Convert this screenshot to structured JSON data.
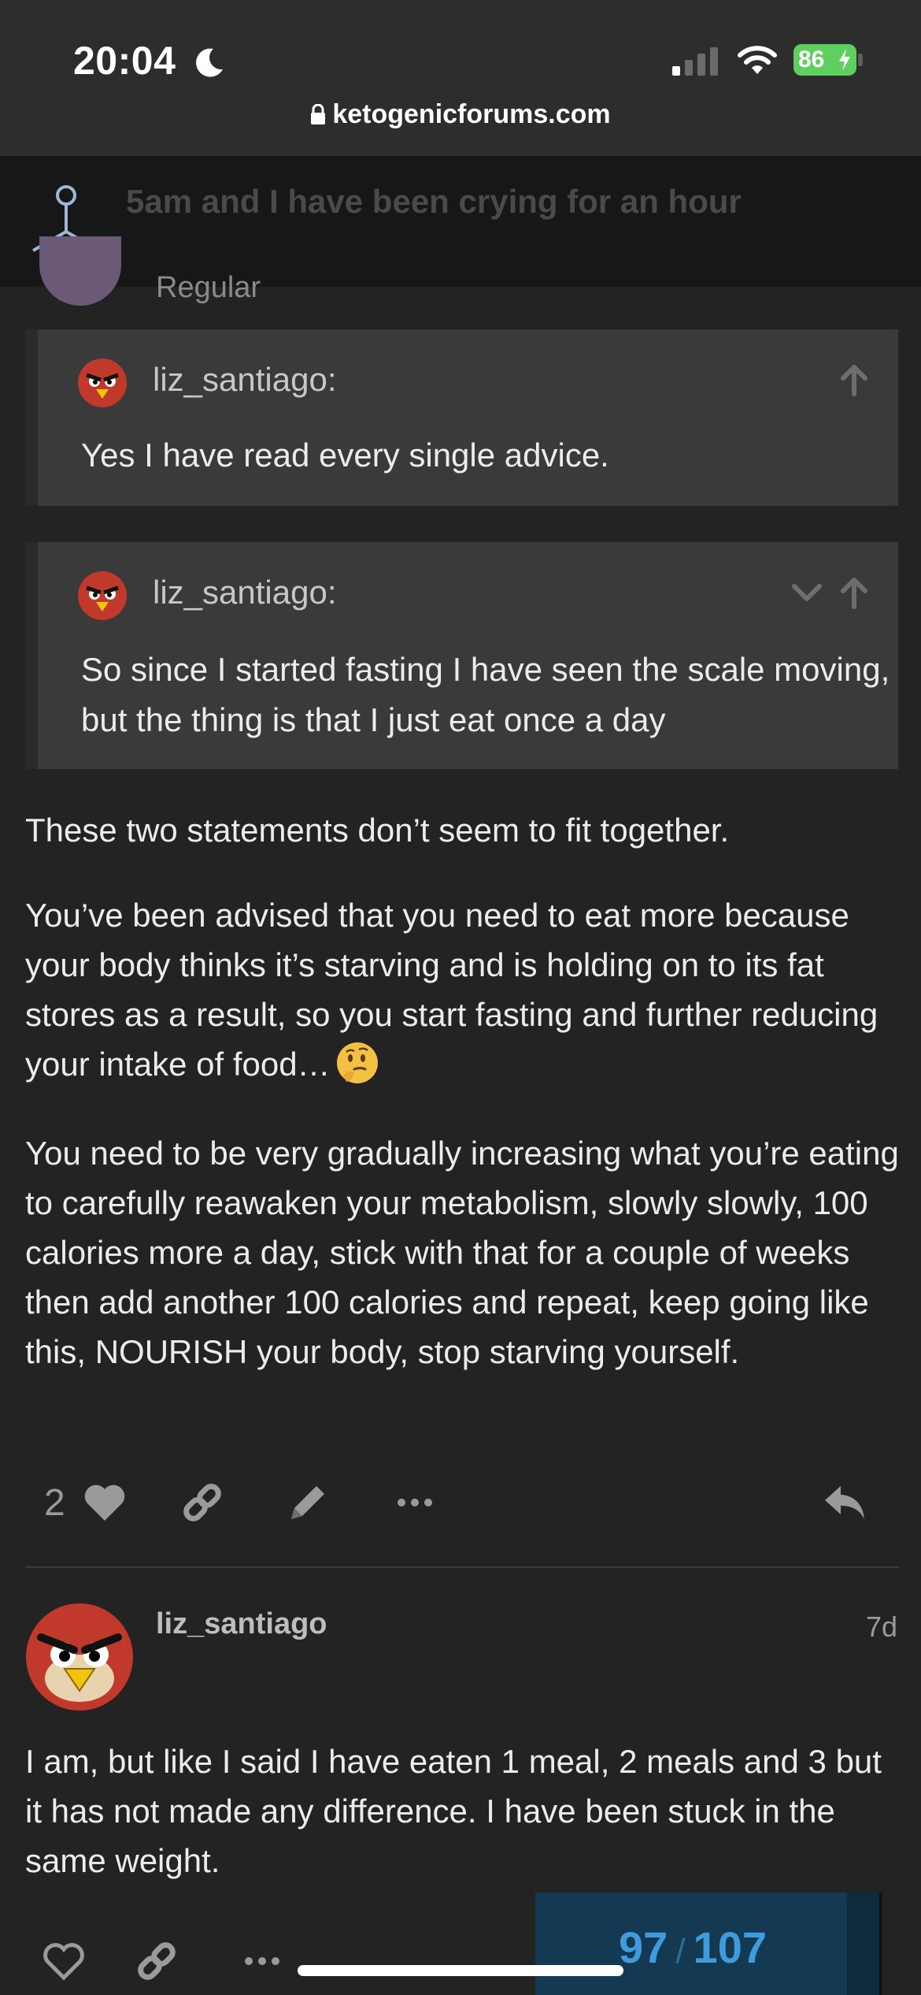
{
  "status_bar": {
    "time": "20:04",
    "battery": "86"
  },
  "browser": {
    "url": "ketogenicforums.com"
  },
  "header": {
    "topic_title": "5am and I have been crying for an hour"
  },
  "previous_post": {
    "user_title": "Regular"
  },
  "quotes": [
    {
      "author": "liz_santiago:",
      "text": "Yes I have read every single advice."
    },
    {
      "author": "liz_santiago:",
      "text": "So since I started fasting I have seen the scale moving, but the thing is that I just eat once a day"
    }
  ],
  "post": {
    "paragraphs": [
      "These two statements don’t seem to fit together.",
      "You’ve been advised that you need to eat more because your body thinks it’s starving and is holding on to its fat stores as a result, so you start fasting and further reducing your intake of food…",
      "You need to be very gradually increasing what you’re eating to carefully reawaken your metabolism, slowly slowly, 100 calories more a day, stick with that for a couple of weeks then add another 100 calories and repeat, keep going like this, NOURISH your body, stop starving yourself."
    ],
    "like_count": "2"
  },
  "next_post": {
    "username": "liz_santiago",
    "age": "7d",
    "text": "I am, but like I said I have eaten 1 meal, 2 meals and 3 but it has not made any difference. I have been stuck in the same weight."
  },
  "progress": {
    "current": "97",
    "separator": "/",
    "total": "107",
    "fraction": 0.9065
  },
  "colors": {
    "background": "#232323",
    "quote_background": "#3a3a3a",
    "accent_blue": "#3f9bdc",
    "battery_green": "#5fcf5f"
  },
  "icons": [
    "moon-icon",
    "signal-icon",
    "wifi-icon",
    "lock-icon",
    "site-logo",
    "arrow-up-icon",
    "chevron-down-icon",
    "thinking-face-emoji",
    "heart-icon",
    "link-icon",
    "pencil-icon",
    "more-icon",
    "reply-icon"
  ]
}
